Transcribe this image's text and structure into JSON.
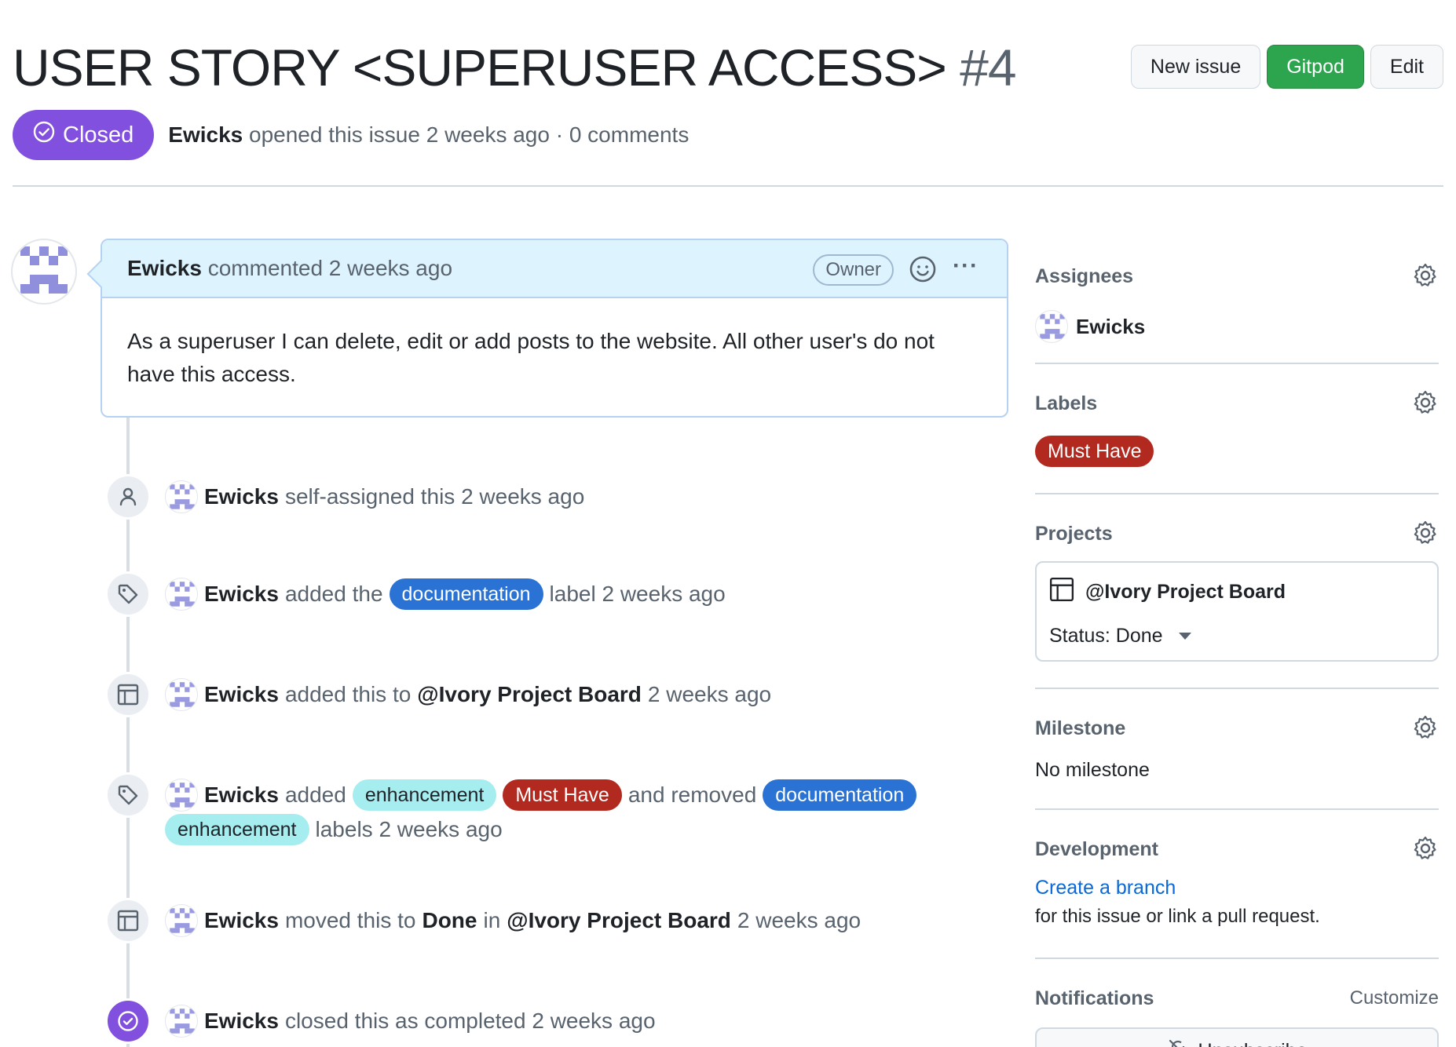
{
  "header": {
    "title": "USER STORY <SUPERUSER ACCESS>",
    "number": "#4",
    "buttons": {
      "new_issue": "New issue",
      "gitpod": "Gitpod",
      "edit": "Edit"
    },
    "state": "Closed",
    "author": "Ewicks",
    "meta": "opened this issue 2 weeks ago · 0 comments"
  },
  "comment": {
    "author": "Ewicks",
    "action": "commented 2 weeks ago",
    "badge": "Owner",
    "menu": "···",
    "body": "As a superuser I can delete, edit or add posts to the website. All other user's do not have this access."
  },
  "timeline": {
    "assigned": {
      "user": "Ewicks",
      "text": "self-assigned this 2 weeks ago"
    },
    "label_added": {
      "user": "Ewicks",
      "pre": "added the",
      "label": "documentation",
      "post": "label 2 weeks ago"
    },
    "project_added": {
      "user": "Ewicks",
      "pre": "added this to",
      "project": "@Ivory Project Board",
      "post": "2 weeks ago"
    },
    "labels_changed": {
      "user": "Ewicks",
      "pre": "added",
      "added": [
        "enhancement",
        "Must Have"
      ],
      "mid": "and removed",
      "removed": [
        "documentation",
        "enhancement"
      ],
      "post": "labels 2 weeks ago"
    },
    "moved": {
      "user": "Ewicks",
      "pre": "moved this to",
      "column": "Done",
      "mid": "in",
      "project": "@Ivory Project Board",
      "post": "2 weeks ago"
    },
    "closed": {
      "user": "Ewicks",
      "text": "closed this as completed 2 weeks ago"
    }
  },
  "sidebar": {
    "assignees": {
      "title": "Assignees",
      "user": "Ewicks"
    },
    "labels": {
      "title": "Labels",
      "label": "Must Have"
    },
    "projects": {
      "title": "Projects",
      "name": "@Ivory Project Board",
      "status": "Status: Done"
    },
    "milestone": {
      "title": "Milestone",
      "value": "No milestone"
    },
    "development": {
      "title": "Development",
      "link": "Create a branch",
      "text": "for this issue or link a pull request."
    },
    "notifications": {
      "title": "Notifications",
      "customize": "Customize",
      "button": "Unsubscribe"
    }
  },
  "colors": {
    "closed_badge": "#8250df",
    "gitpod_button": "#2da44e",
    "label_documentation": "#2a72d4",
    "label_enhancement": "#a6edf0",
    "label_must_have": "#b2291f",
    "link": "#0969da"
  }
}
